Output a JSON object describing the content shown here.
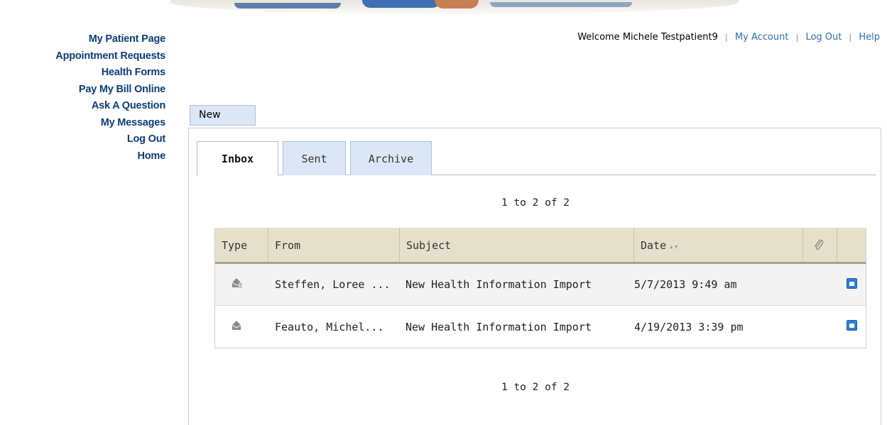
{
  "nav": {
    "items": [
      {
        "label": "My Patient Page"
      },
      {
        "label": "Appointment Requests"
      },
      {
        "label": "Health Forms"
      },
      {
        "label": "Pay My Bill Online"
      },
      {
        "label": "Ask A Question"
      },
      {
        "label": "My Messages"
      },
      {
        "label": "Log Out"
      },
      {
        "label": "Home"
      }
    ]
  },
  "topbar": {
    "welcome": "Welcome Michele Testpatient9",
    "separator": "|",
    "my_account": "My Account",
    "log_out": "Log Out",
    "help": "Help"
  },
  "toolbar": {
    "new_label": "New"
  },
  "tabs": {
    "inbox": "Inbox",
    "sent": "Sent",
    "archive": "Archive"
  },
  "pager": {
    "top": "1 to 2 of 2",
    "bottom": "1 to 2 of 2"
  },
  "table": {
    "columns": [
      "Type",
      "From",
      "Subject",
      "Date"
    ],
    "rows": [
      {
        "from": "Steffen, Loree ...",
        "subject": "New Health Information Import",
        "date": "5/7/2013 9:49 am"
      },
      {
        "from": "Feauto, Michel...",
        "subject": "New Health Information Import",
        "date": "4/19/2013 3:39 pm"
      }
    ]
  },
  "colors": {
    "nav_text": "#0c3c78",
    "link": "#2b6cb0",
    "tab_bg": "#dbe7f6",
    "header_bg": "#e5e0cc",
    "archive_icon": "#2f7fd6"
  },
  "icons": {
    "message_type": "message-envelope-icon",
    "attachment": "paperclip-icon",
    "archive": "archive-box-icon",
    "sort": "sort-arrows-icon"
  }
}
